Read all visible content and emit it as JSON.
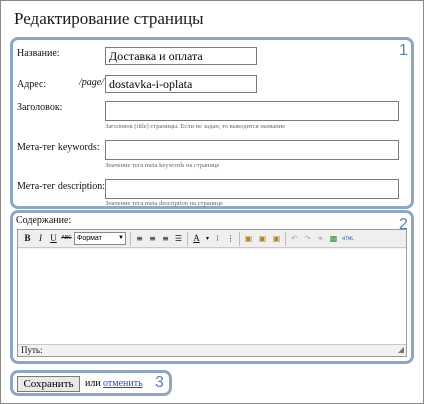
{
  "page": {
    "title": "Редактирование страницы"
  },
  "section1": {
    "number": "1",
    "name": {
      "label": "Название:",
      "value": "Доставка и оплата"
    },
    "address": {
      "label": "Адрес:",
      "prefix": "/page/",
      "value": "dostavka-i-oplata"
    },
    "heading": {
      "label": "Заголовок:",
      "value": "",
      "hint": "Заголовок (title) страницы. Если не задан, то выводится название"
    },
    "keywords": {
      "label": "Мета-тег keywords:",
      "value": "",
      "hint": "Значение тега meta keywords на странице"
    },
    "description": {
      "label": "Мета-тег description:",
      "value": "",
      "hint": "Значение тега meta description на странице"
    }
  },
  "section2": {
    "number": "2",
    "content_label": "Содержание:",
    "editor": {
      "toolbar": {
        "bold": "B",
        "italic": "I",
        "underline": "U",
        "strike": "ABC",
        "format_select": "Формат",
        "font_color": "A",
        "html_button": "HTML"
      },
      "path_label": "Путь:"
    }
  },
  "section3": {
    "number": "3",
    "save_label": "Сохранить",
    "or_text": "или",
    "cancel_label": "отменить"
  }
}
